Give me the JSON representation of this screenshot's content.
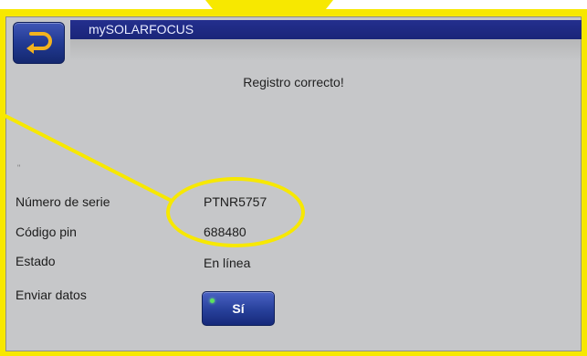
{
  "header": {
    "title": "mySOLARFOCUS"
  },
  "message": "Registro correcto!",
  "small_mark": "\"",
  "fields": [
    {
      "label": "Número de serie",
      "value": "PTNR5757"
    },
    {
      "label": "Código pin",
      "value": "688480"
    },
    {
      "label": "Estado",
      "value": "En línea"
    },
    {
      "label": "Enviar datos",
      "value": "Sí"
    }
  ],
  "colors": {
    "frame": "#f7e800",
    "screen": "#c6c7c9",
    "title_bar": "#1f2a85",
    "button": "#27409a",
    "led": "#5ce35c"
  },
  "icons": {
    "back": "return-arrow-icon",
    "status": "green-led-icon"
  }
}
